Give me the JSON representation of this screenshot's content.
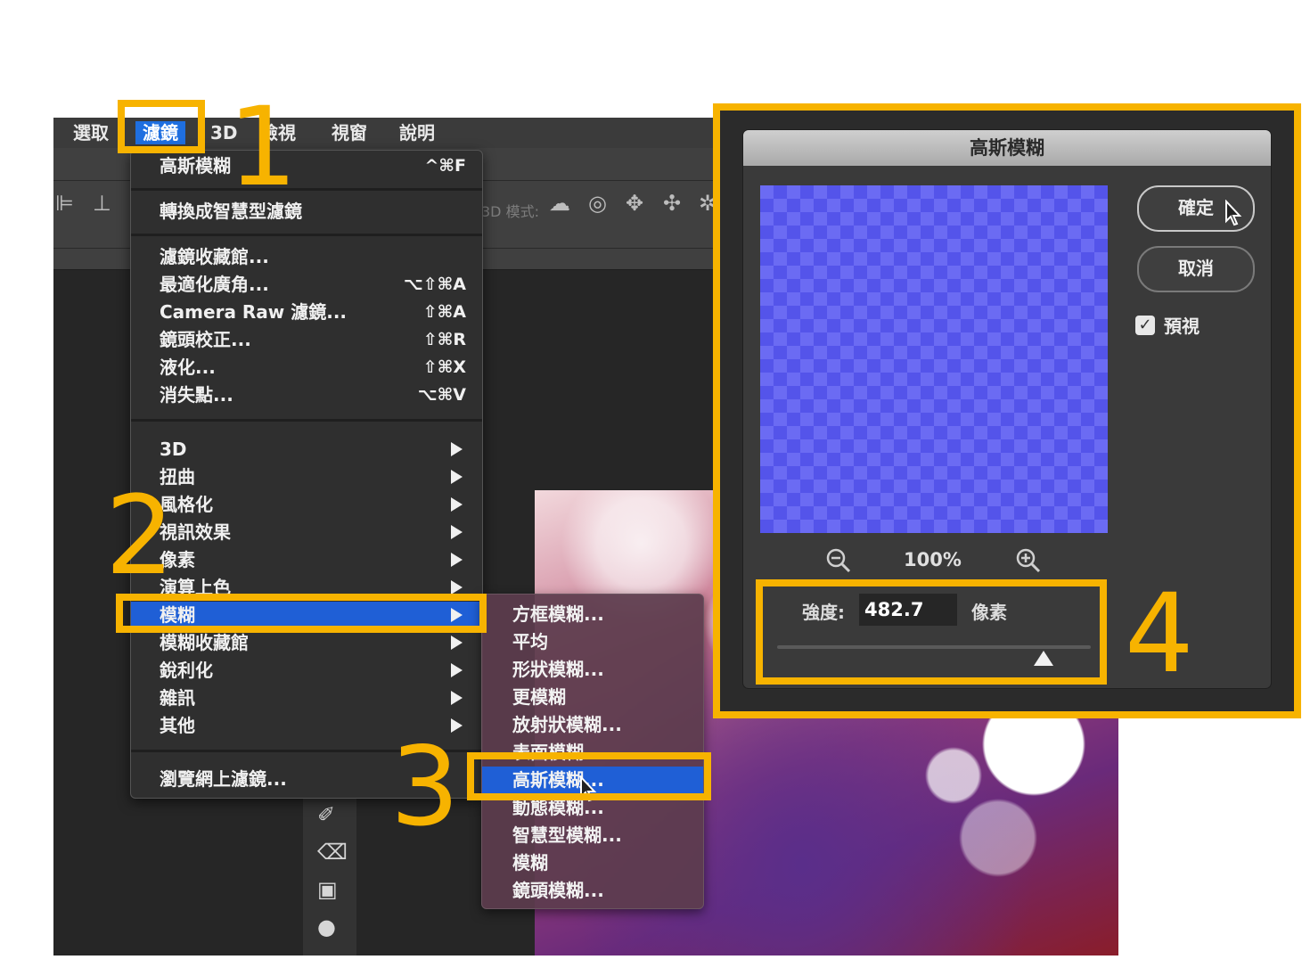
{
  "menubar": {
    "items": [
      "選取",
      "濾鏡",
      "3D",
      "檢視",
      "視窗",
      "說明"
    ],
    "active": "濾鏡"
  },
  "options_bar": {
    "mode_label": "3D 模式:"
  },
  "filter_menu": {
    "last_filter": {
      "label": "高斯模糊",
      "shortcut": "^⌘F"
    },
    "convert_smart": "轉換成智慧型濾鏡",
    "group2": [
      {
        "label": "濾鏡收藏館...",
        "shortcut": ""
      },
      {
        "label": "最適化廣角...",
        "shortcut": "⌥⇧⌘A"
      },
      {
        "label": "Camera Raw 濾鏡...",
        "shortcut": "⇧⌘A"
      },
      {
        "label": "鏡頭校正...",
        "shortcut": "⇧⌘R"
      },
      {
        "label": "液化...",
        "shortcut": "⇧⌘X"
      },
      {
        "label": "消失點...",
        "shortcut": "⌥⌘V"
      }
    ],
    "group3": [
      "3D",
      "扭曲",
      "風格化",
      "視訊效果",
      "像素",
      "演算上色",
      "模糊",
      "模糊收藏館",
      "銳利化",
      "雜訊",
      "其他"
    ],
    "highlighted": "模糊",
    "browse": "瀏覽網上濾鏡..."
  },
  "blur_submenu": {
    "items": [
      "方框模糊...",
      "平均",
      "形狀模糊...",
      "更模糊",
      "放射狀模糊...",
      "表面模糊...",
      "高斯模糊...",
      "動態模糊...",
      "智慧型模糊...",
      "模糊",
      "鏡頭模糊..."
    ],
    "highlighted": "高斯模糊..."
  },
  "dialog": {
    "title": "高斯模糊",
    "ok": "確定",
    "cancel": "取消",
    "preview_label": "預視",
    "preview_checked": true,
    "zoom": "100%",
    "strength_label": "強度:",
    "strength_value": "482.7",
    "unit": "像素",
    "slider_fraction": 0.85
  },
  "annotations": {
    "steps": [
      "1",
      "2",
      "3",
      "4"
    ],
    "color": "#f7b300"
  },
  "icons": {
    "zoom_out": "zoom-out-icon",
    "zoom_in": "zoom-in-icon",
    "cursor": "arrow-cursor-icon",
    "submenu_arrow": "triangle-right-icon"
  }
}
